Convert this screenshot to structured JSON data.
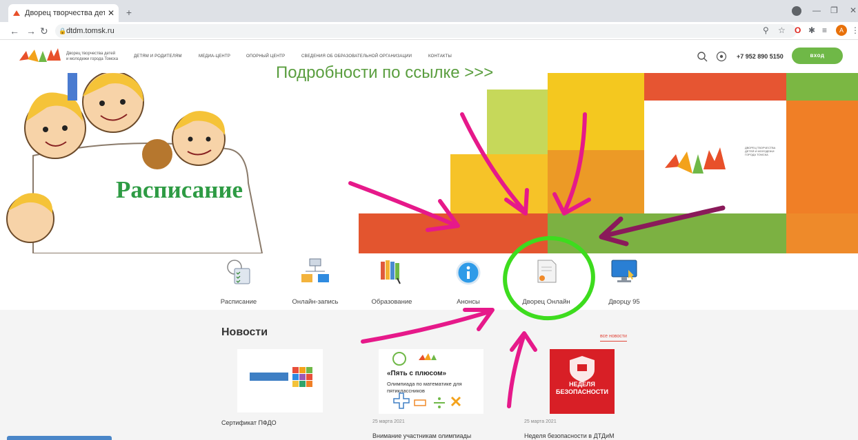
{
  "browser": {
    "tab_title": "Дворец творчества детей и мо",
    "tab_close": "✕",
    "new_tab": "+",
    "url": "dtdm.tomsk.ru",
    "avatar_letter": "A",
    "window_min": "—",
    "window_max": "❐",
    "window_close": "✕"
  },
  "site": {
    "logo_line1": "Дворец творчества детей",
    "logo_line2": "и молодежи города Томска",
    "menu": [
      "Детям и родителям",
      "Медиа-центр",
      "Опорный центр",
      "Сведения об образовательной организации",
      "Контакты"
    ],
    "phone": "+7 952 890 5150",
    "login": "вход"
  },
  "banner": {
    "caption": "Подробности по ссылке >>>",
    "schedule": "Расписание",
    "logo_side_text": "ДВОРЕЦ ТВОРЧЕСТВА ДЕТЕЙ И МОЛОДЕЖИ ГОРОДА ТОМСКА"
  },
  "tiles": [
    {
      "label": "Расписание",
      "icon": "schedule-icon"
    },
    {
      "label": "Онлайн-запись",
      "icon": "online-signup-icon"
    },
    {
      "label": "Образование",
      "icon": "books-icon"
    },
    {
      "label": "Анонсы",
      "icon": "info-icon"
    },
    {
      "label": "Дворец Онлайн",
      "icon": "certificate-icon"
    },
    {
      "label": "Дворцу 95",
      "icon": "monitor-icon"
    }
  ],
  "news": {
    "title": "Новости",
    "all_link": "все новости",
    "items": [
      {
        "caption": "Сертификат ПФДО",
        "date": ""
      },
      {
        "caption": "Внимание участникам олимпиады",
        "date": "25 марта 2021",
        "img_title": "«Пять с плюсом»",
        "img_sub": "Олимпиада по математике для пятиклассников"
      },
      {
        "caption": "Неделя безопасности в ДТДиМ",
        "date": "25 марта 2021",
        "img_title": "НЕДЕЛЯ БЕЗОПАСНОСТИ"
      }
    ]
  },
  "colors": {
    "accent_green": "#6fb847",
    "annotation_pink": "#e6198a",
    "annotation_green": "#3ddc1e",
    "annotation_purple": "#8a1a5a"
  }
}
